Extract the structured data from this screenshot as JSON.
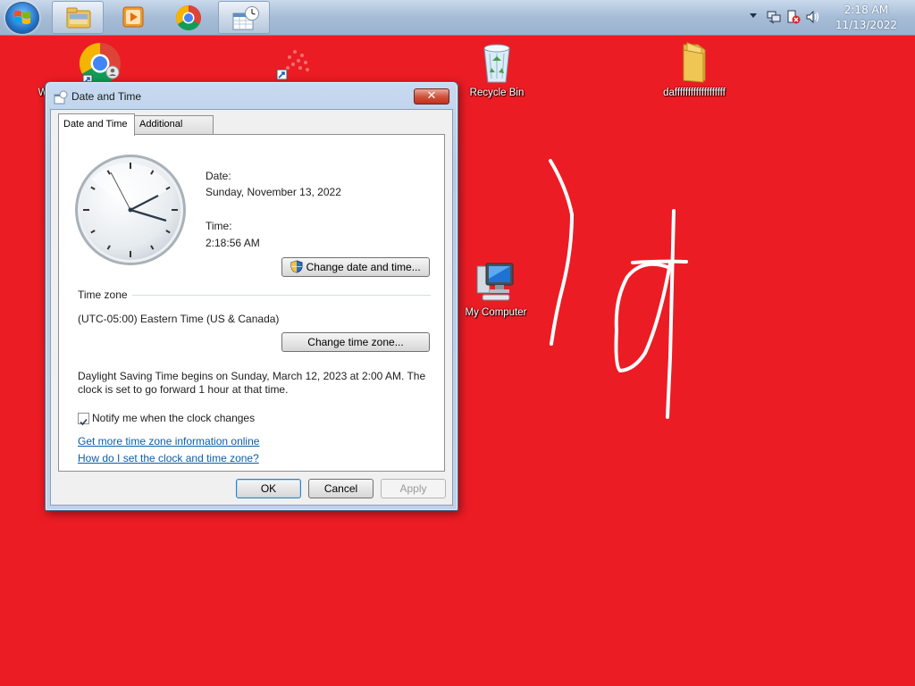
{
  "taskbar": {
    "clock_time": "2:18 AM",
    "clock_date": "11/13/2022"
  },
  "desktop": {
    "icons": [
      {
        "label": "W"
      },
      {
        "label": "Recycle Bin"
      },
      {
        "label": "dafffffffffffffffffff"
      },
      {
        "label": "My Computer"
      }
    ],
    "background_color": "#ec1c24"
  },
  "dialog": {
    "title": "Date and Time",
    "close_label": "✕",
    "tabs": [
      {
        "label": "Date and Time",
        "selected": true
      },
      {
        "label": "Additional Clocks",
        "selected": false
      }
    ],
    "date_label": "Date:",
    "date_value": "Sunday, November 13, 2022",
    "time_label": "Time:",
    "time_value": "2:18:56 AM",
    "change_datetime_button": "Change date and time...",
    "timezone_header": "Time zone",
    "timezone_value": "(UTC-05:00) Eastern Time (US & Canada)",
    "change_timezone_button": "Change time zone...",
    "dst_line1": "Daylight Saving Time begins on Sunday, March 12, 2023 at 2:00 AM. The",
    "dst_line2": "clock is set to go forward 1 hour at that time.",
    "notify_label": "Notify me when the clock changes",
    "notify_checked": true,
    "link_timezone_info": "Get more time zone information online",
    "link_how_to_set": "How do I set the clock and time zone?",
    "ok_button": "OK",
    "cancel_button": "Cancel",
    "apply_button": "Apply"
  }
}
